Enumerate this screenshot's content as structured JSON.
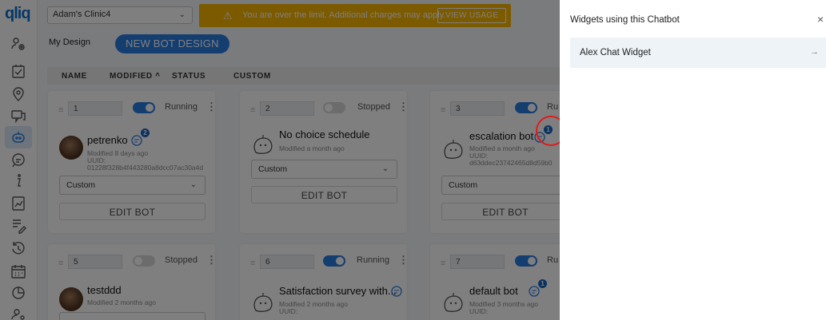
{
  "app": {
    "logo": "qliq"
  },
  "sidebar": {
    "icons": [
      "users-icon",
      "checklist-icon",
      "location-icon",
      "chat-bubbles-icon",
      "chatbot-icon",
      "message-icon",
      "info-icon",
      "reports-icon",
      "edit-icon",
      "history-icon",
      "calendar-icon",
      "analytics-icon",
      "settings-icon"
    ]
  },
  "topbar": {
    "clinic": "Adam's Clinic4",
    "warning_icon": "⚠",
    "warning_text": "You are over the limit. Additional charges may apply.",
    "view_usage": "VIEW USAGE"
  },
  "design": {
    "label": "My Design",
    "new_bot_button": "NEW BOT DESIGN"
  },
  "sort": {
    "name": "NAME",
    "modified": "MODIFIED ^",
    "status": "STATUS",
    "custom": "CUSTOM"
  },
  "cards": [
    {
      "number": "1",
      "status": "Running",
      "name": "petrenko",
      "badge": "2",
      "modified": "Modified 8 days ago",
      "uuid_label": "UUID:",
      "uuid": "01228f328b4f443280a8dcc07ac30a4d",
      "select": "Custom",
      "edit": "EDIT BOT"
    },
    {
      "number": "2",
      "status": "Stopped",
      "name": "No choice schedule",
      "modified": "Modified a month ago",
      "select": "Custom",
      "edit": "EDIT BOT"
    },
    {
      "number": "3",
      "status": "Ru",
      "name": "escalation bot",
      "badge": "1",
      "modified": "Modified a month ago",
      "uuid_label": "UUID:",
      "uuid": "d63ddec23742465d8d59b0",
      "select": "Custom",
      "edit": "EDIT BOT"
    },
    {
      "number": "5",
      "status": "Stopped",
      "name": "testddd",
      "modified": "Modified 2 months ago"
    },
    {
      "number": "6",
      "status": "Running",
      "name": "Satisfaction survey with...",
      "modified": "Modified 2 months ago",
      "uuid_label": "UUID:"
    },
    {
      "number": "7",
      "status": "Ru",
      "name": "default bot",
      "badge": "1",
      "modified": "Modified 3 months ago",
      "uuid_label": "UUID:"
    }
  ],
  "panel": {
    "title": "Widgets using this Chatbot",
    "close": "×",
    "widget": "Alex Chat Widget",
    "widget_arrow": "→"
  },
  "colors": {
    "primary": "#2a7de1",
    "warning": "#f8b400",
    "highlight": "#e01b1b",
    "badge": "#1565c0"
  }
}
